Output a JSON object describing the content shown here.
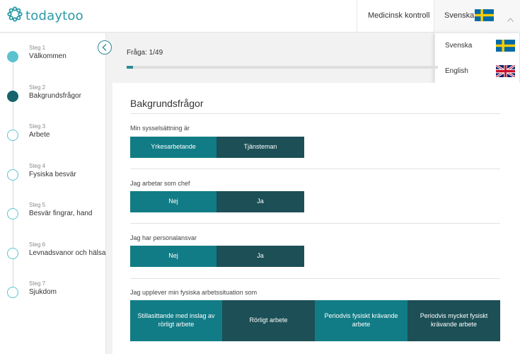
{
  "app": {
    "logo_text": "todaytoo"
  },
  "header": {
    "medical_link": "Medicinsk kontroll",
    "language": {
      "current_label": "Svenska",
      "current_flag": "sweden-flag-icon",
      "toggle_icon": "chevron-up-icon"
    }
  },
  "language_menu": {
    "options": [
      {
        "label": "Svenska",
        "flag": "sweden-flag-icon"
      },
      {
        "label": "English",
        "flag": "uk-flag-icon"
      }
    ]
  },
  "sidebar": {
    "collapse_icon": "chevron-left-icon",
    "steps": [
      {
        "num": "Steg 1",
        "title": "Välkommen",
        "state": "done"
      },
      {
        "num": "Steg 2",
        "title": "Bakgrundsfrågor",
        "state": "current"
      },
      {
        "num": "Steg 3",
        "title": "Arbete",
        "state": "todo"
      },
      {
        "num": "Steg 4",
        "title": "Fysiska besvär",
        "state": "todo"
      },
      {
        "num": "Steg 5",
        "title": "Besvär fingrar, hand",
        "state": "todo"
      },
      {
        "num": "Steg 6",
        "title": "Levnadsvanor och hälsa",
        "state": "todo"
      },
      {
        "num": "Steg 7",
        "title": "Sjukdom",
        "state": "todo"
      }
    ]
  },
  "progress": {
    "label": "Fråga: 1/49",
    "fraction": 0.0204
  },
  "form": {
    "title": "Bakgrundsfrågor",
    "questions": [
      {
        "label": "Min sysselsättning är",
        "options": [
          "Yrkesarbetande",
          "Tjänsteman"
        ],
        "selected": 0
      },
      {
        "label": "Jag arbetar som chef",
        "options": [
          "Nej",
          "Ja"
        ],
        "selected": 0
      },
      {
        "label": "Jag har personalansvar",
        "options": [
          "Nej",
          "Ja"
        ],
        "selected": 0
      },
      {
        "label": "Jag upplever min fysiska arbetssituation som",
        "options": [
          "Stillasittande med inslag av rörligt arbete",
          "Rörligt arbete",
          "Periodvis fysiskt krävande arbete",
          "Periodvis mycket fysiskt krävande arbete"
        ],
        "selected": 0
      }
    ]
  },
  "colors": {
    "brand": "#2a9aa6",
    "selected": "#117c86",
    "unselected": "#1c4f56",
    "step_done": "#5bc3cf",
    "step_current": "#17636b"
  }
}
